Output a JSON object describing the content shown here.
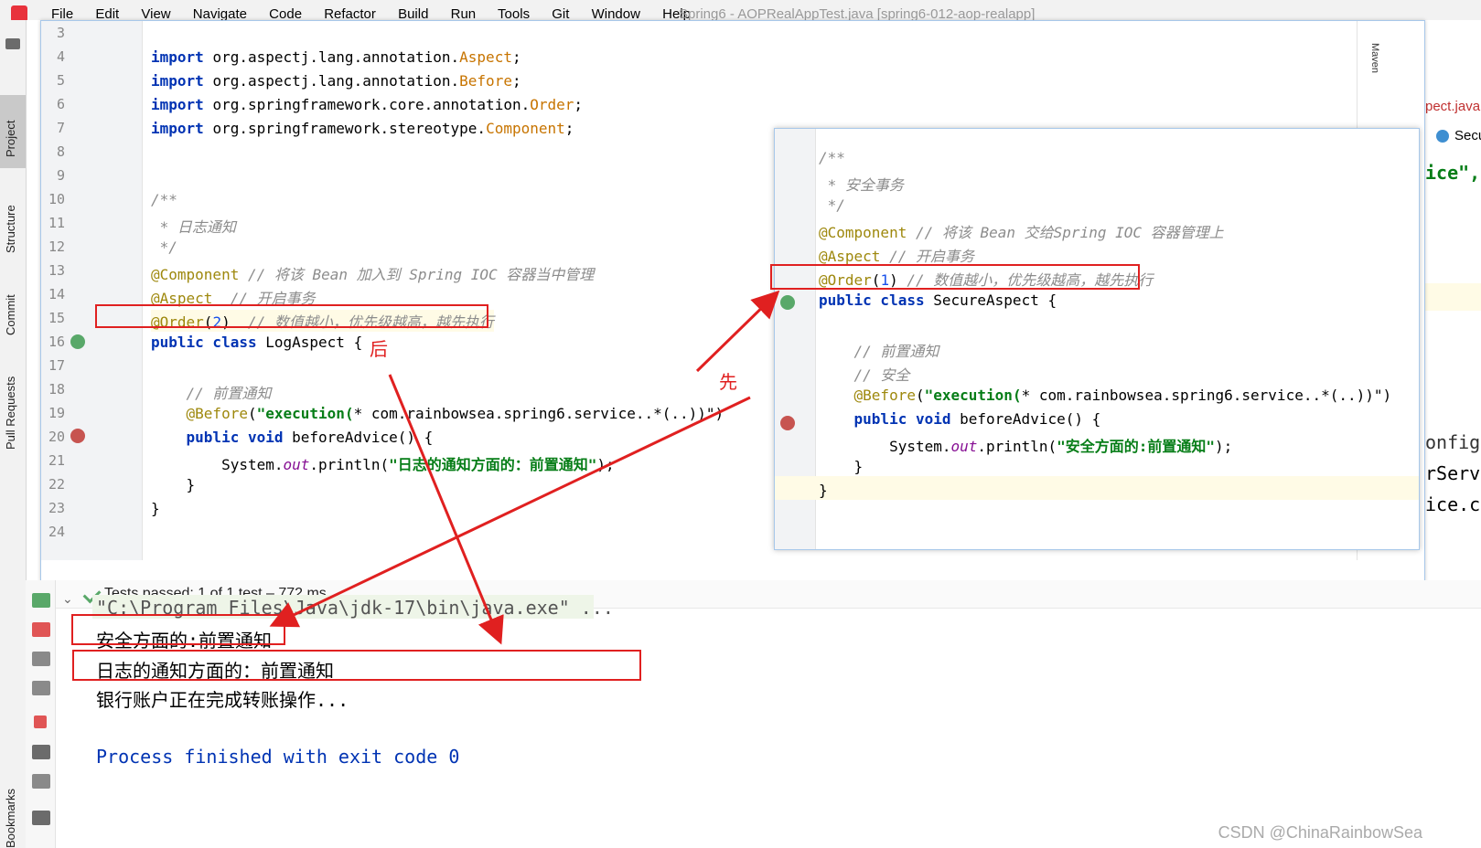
{
  "menu": {
    "items": [
      "File",
      "Edit",
      "View",
      "Navigate",
      "Code",
      "Refactor",
      "Build",
      "Run",
      "Tools",
      "Git",
      "Window",
      "Help"
    ],
    "window_title": "Spring6 - AOPRealAppTest.java [spring6-012-aop-realapp]"
  },
  "side_tabs": {
    "project": "Project",
    "structure": "Structure",
    "commit": "Commit",
    "pull_requests": "Pull Requests",
    "bookmarks": "Bookmarks",
    "maven": "Maven"
  },
  "left_editor": {
    "line_numbers": [
      "3",
      "4",
      "5",
      "6",
      "7",
      "8",
      "9",
      "10",
      "11",
      "12",
      "13",
      "14",
      "15",
      "16",
      "17",
      "18",
      "19",
      "20",
      "21",
      "22",
      "23",
      "24"
    ],
    "lines": [
      "",
      "import org.aspectj.lang.annotation.Aspect;",
      "import org.aspectj.lang.annotation.Before;",
      "import org.springframework.core.annotation.Order;",
      "import org.springframework.stereotype.Component;",
      "",
      "",
      "/**",
      " * 日志通知",
      " */",
      "@Component // 将该 Bean 加入到 Spring IOC 容器当中管理",
      "@Aspect  // 开启事务",
      "@Order(2)  // 数值越小，优先级越高，越先执行",
      "public class LogAspect {",
      "",
      "    // 前置通知",
      "    @Before(\"execution(* com.rainbowsea.spring6.service..*(..))\")",
      "    public void beforeAdvice() {",
      "        System.out.println(\"日志的通知方面的：前置通知\");",
      "    }",
      "}",
      ""
    ]
  },
  "right_editor": {
    "lines": [
      "/**",
      " * 安全事务",
      " */",
      "@Component // 将该 Bean 交给Spring IOC 容器管理上",
      "@Aspect // 开启事务",
      "@Order(1) // 数值越小，优先级越高，越先执行",
      "public class SecureAspect {",
      "",
      "    // 前置通知",
      "    // 安全",
      "    @Before(\"execution(* com.rainbowsea.spring6.service..*(..))\")",
      "    public void beforeAdvice() {",
      "        System.out.println(\"安全方面的:前置通知\");",
      "    }",
      "}"
    ]
  },
  "right_edge": {
    "tab": "pect.java",
    "item": "Secu",
    "code1": "ice\", ,",
    "code2": "onfigLo",
    "code3": "rServi",
    "code4": "ice.c"
  },
  "annotations": {
    "later": "后",
    "first": "先"
  },
  "console": {
    "status": "Tests passed: 1 of 1 test – 772 ms",
    "lines": [
      "\"C:\\Program Files\\Java\\jdk-17\\bin\\java.exe\" ...",
      "安全方面的:前置通知",
      "日志的通知方面的：前置通知",
      "银行账户正在完成转账操作...",
      "",
      "Process finished with exit code 0"
    ]
  },
  "watermark": "CSDN @ChinaRainbowSea",
  "colors": {
    "keyword": "#0033b3",
    "annotation": "#9e880d",
    "string": "#067d17",
    "comment": "#8c8c8c",
    "red_markup": "#e02020"
  }
}
